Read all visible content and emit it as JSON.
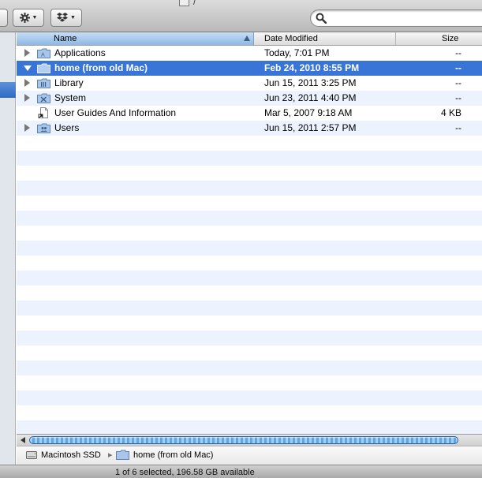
{
  "window": {
    "title": "/"
  },
  "toolbar": {
    "action_icon": "gear-icon",
    "dropbox_icon": "dropbox-icon",
    "search": {
      "placeholder": "",
      "value": ""
    }
  },
  "columns": {
    "name": "Name",
    "date": "Date Modified",
    "size": "Size"
  },
  "rows": [
    {
      "name": "Applications",
      "date": "Today, 7:01 PM",
      "size": "--",
      "icon": "applications-folder-icon",
      "expandable": true,
      "selected": false
    },
    {
      "name": "home (from old Mac)",
      "date": "Feb 24, 2010 8:55 PM",
      "size": "--",
      "icon": "folder-icon",
      "expandable": true,
      "selected": true
    },
    {
      "name": "Library",
      "date": "Jun 15, 2011 3:25 PM",
      "size": "--",
      "icon": "library-folder-icon",
      "expandable": true,
      "selected": false
    },
    {
      "name": "System",
      "date": "Jun 23, 2011 4:40 PM",
      "size": "--",
      "icon": "system-folder-icon",
      "expandable": true,
      "selected": false
    },
    {
      "name": "User Guides And Information",
      "date": "Mar 5, 2007 9:18 AM",
      "size": "4 KB",
      "icon": "alias-document-icon",
      "expandable": false,
      "selected": false
    },
    {
      "name": "Users",
      "date": "Jun 15, 2011 2:57 PM",
      "size": "--",
      "icon": "users-folder-icon",
      "expandable": true,
      "selected": false
    }
  ],
  "pathbar": {
    "disk": "Macintosh SSD",
    "separator": "▸",
    "folder": "home (from old Mac)"
  },
  "status": {
    "text": "1 of 6 selected, 196.58 GB available"
  },
  "colors": {
    "selection": "#3875d7",
    "stripe": "#edf3fe",
    "scroll_thumb": "#5fa4e3"
  }
}
